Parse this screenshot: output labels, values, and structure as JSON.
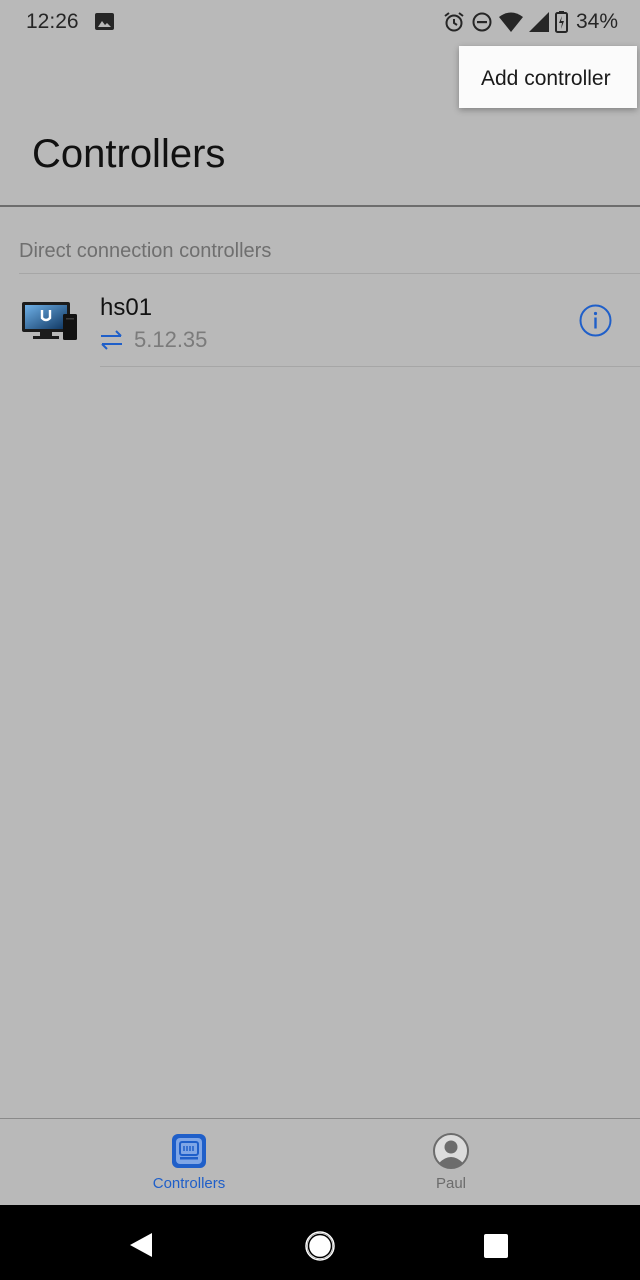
{
  "status_bar": {
    "time": "12:26",
    "battery_percent": "34%",
    "icons": [
      "image-icon",
      "alarm-icon",
      "do-not-disturb-icon",
      "wifi-icon",
      "cellular-signal-icon",
      "battery-charging-icon"
    ]
  },
  "header": {
    "title": "Controllers"
  },
  "overflow_menu": {
    "items": [
      {
        "label": "Add controller"
      }
    ]
  },
  "sections": [
    {
      "header": "Direct connection controllers",
      "controllers": [
        {
          "name": "hs01",
          "version": "5.12.35",
          "icon": "cloud-key-device-icon",
          "status_icon": "sync-arrows-icon",
          "action_icon": "info-icon"
        }
      ]
    }
  ],
  "bottom_nav": {
    "tabs": [
      {
        "label": "Controllers",
        "icon": "controllers-icon",
        "active": true
      },
      {
        "label": "Paul",
        "icon": "avatar-icon",
        "active": false
      }
    ]
  },
  "colors": {
    "accent": "#1f5fc9",
    "background": "#b9b9b9",
    "menu_background": "#fbfbfb",
    "system_nav": "#000000"
  }
}
